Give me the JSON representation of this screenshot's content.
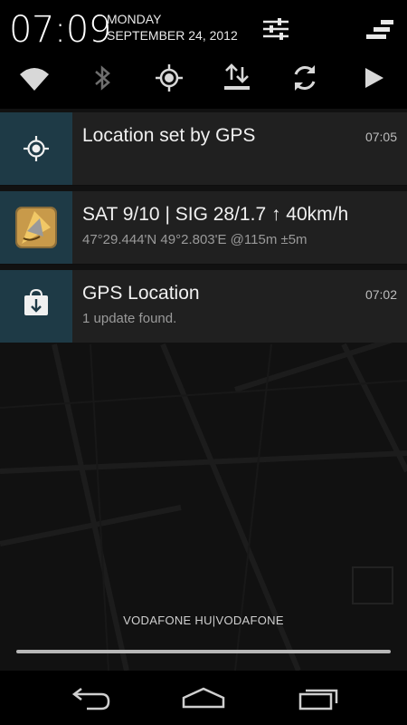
{
  "status": {
    "time": "07:09",
    "day": "MONDAY",
    "date": "SEPTEMBER 24, 2012"
  },
  "header_icons": [
    "settings-sliders-icon",
    "clear-all-icon"
  ],
  "quick_settings": [
    "wifi-icon",
    "bluetooth-icon",
    "gps-icon",
    "data-icon",
    "sync-icon",
    "play-icon"
  ],
  "notifications": [
    {
      "title": "Location set by GPS",
      "time": "07:05",
      "icon": "gps-target-icon"
    },
    {
      "title": "SAT 9/10 | SIG 28/1.7 ↑ 40km/h",
      "subtitle": "47°29.444'N 49°2.803'E @115m ±5m",
      "icon": "gps-app-icon"
    },
    {
      "title": "GPS Location",
      "subtitle": "1 update found.",
      "time": "07:02",
      "icon": "store-bag-icon"
    }
  ],
  "carrier": "VODAFONE HU|VODAFONE",
  "navbar": [
    "back-icon",
    "home-icon",
    "recents-icon"
  ],
  "colors": {
    "icon_box": "#1e3a46",
    "notification_bg": "#202020",
    "accent_orange": "#e89a2c"
  }
}
